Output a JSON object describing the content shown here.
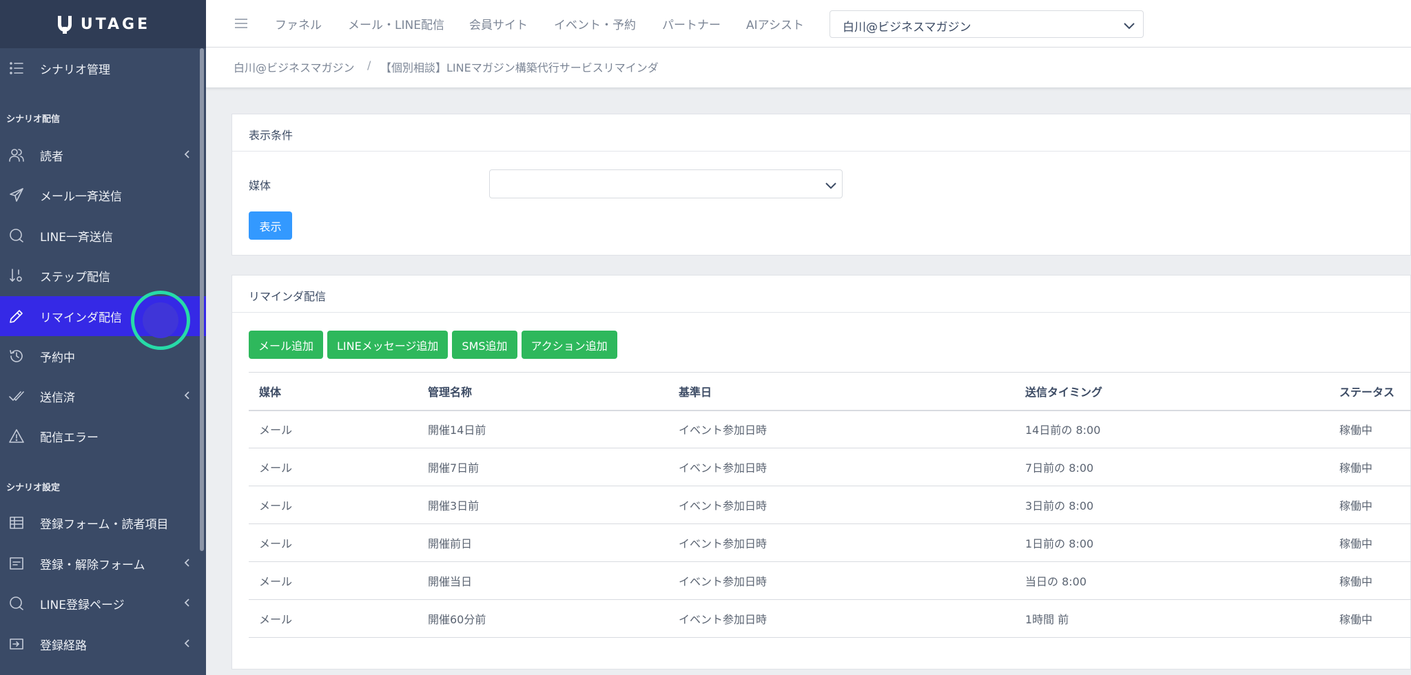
{
  "brand": {
    "name": "UTAGE"
  },
  "sidebar": {
    "top_item": {
      "label": "シナリオ管理",
      "icon": "list-icon"
    },
    "section_delivery": "シナリオ配信",
    "delivery_items": [
      {
        "label": "読者",
        "icon": "users-icon",
        "has_children": true
      },
      {
        "label": "メール一斉送信",
        "icon": "paper-plane-icon",
        "has_children": false
      },
      {
        "label": "LINE一斉送信",
        "icon": "chat-bubble-icon",
        "has_children": false
      },
      {
        "label": "ステップ配信",
        "icon": "sort-numeric-icon",
        "has_children": false
      },
      {
        "label": "リマインダ配信",
        "icon": "pencil-icon",
        "has_children": false,
        "active": true
      },
      {
        "label": "予約中",
        "icon": "history-icon",
        "has_children": false
      },
      {
        "label": "送信済",
        "icon": "double-check-icon",
        "has_children": true
      },
      {
        "label": "配信エラー",
        "icon": "warning-icon",
        "has_children": false
      }
    ],
    "section_settings": "シナリオ設定",
    "settings_items": [
      {
        "label": "登録フォーム・読者項目",
        "icon": "table-icon",
        "has_children": false
      },
      {
        "label": "登録・解除フォーム",
        "icon": "form-icon",
        "has_children": true
      },
      {
        "label": "LINE登録ページ",
        "icon": "chat-bubble-icon",
        "has_children": true
      },
      {
        "label": "登録経路",
        "icon": "login-icon",
        "has_children": true
      }
    ]
  },
  "header": {
    "nav": [
      "ファネル",
      "メール・LINE配信",
      "会員サイト",
      "イベント・予約",
      "パートナー",
      "AIアシスト"
    ],
    "account_selected": "白川@ビジネスマガジン"
  },
  "breadcrumb": {
    "items": [
      "白川@ビジネスマガジン",
      "【個別相談】LINEマガジン構築代行サービスリマインダ"
    ],
    "separator": "/"
  },
  "filter_card": {
    "title": "表示条件",
    "media_label": "媒体",
    "media_value": "",
    "show_button": "表示"
  },
  "reminder_card": {
    "title": "リマインダ配信",
    "buttons": [
      "メール追加",
      "LINEメッセージ追加",
      "SMS追加",
      "アクション追加"
    ],
    "columns": [
      "媒体",
      "管理名称",
      "基準日",
      "送信タイミング",
      "ステータス"
    ],
    "rows": [
      [
        "メール",
        "開催14日前",
        "イベント参加日時",
        "14日前の 8:00",
        "稼働中"
      ],
      [
        "メール",
        "開催7日前",
        "イベント参加日時",
        "7日前の 8:00",
        "稼働中"
      ],
      [
        "メール",
        "開催3日前",
        "イベント参加日時",
        "3日前の 8:00",
        "稼働中"
      ],
      [
        "メール",
        "開催前日",
        "イベント参加日時",
        "1日前の 8:00",
        "稼働中"
      ],
      [
        "メール",
        "開催当日",
        "イベント参加日時",
        "当日の 8:00",
        "稼働中"
      ],
      [
        "メール",
        "開催60分前",
        "イベント参加日時",
        "1時間 前",
        "稼働中"
      ]
    ]
  },
  "colors": {
    "sidebar_bg": "#3a4a66",
    "sidebar_active": "#3529e6",
    "primary": "#3399ff",
    "success": "#2eb85c"
  }
}
